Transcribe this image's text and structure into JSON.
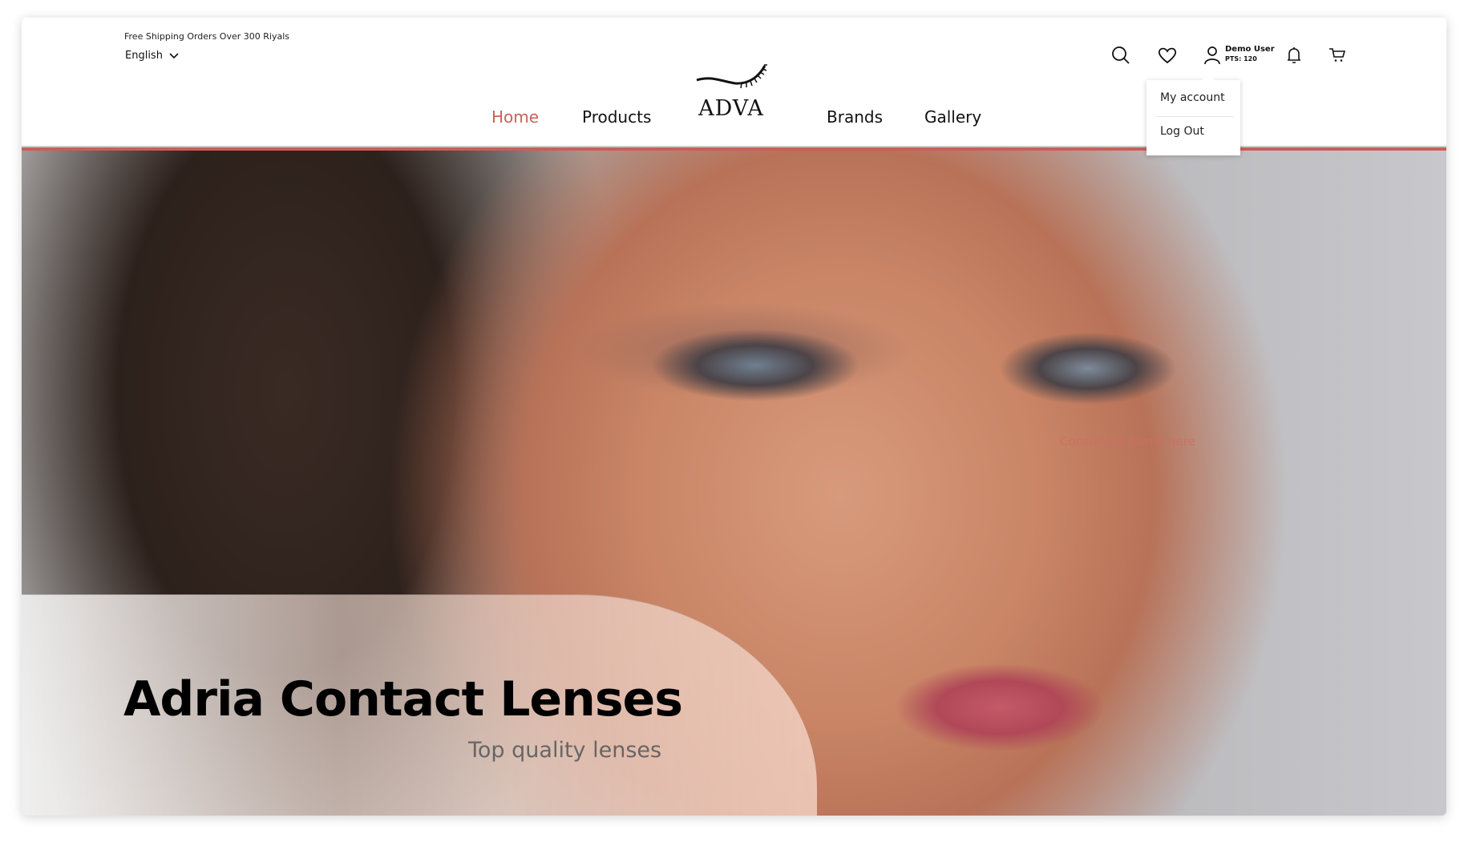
{
  "topbar": {
    "shipping_text": "Free Shipping Orders Over 300 Riyals",
    "language": "English"
  },
  "nav": {
    "items": [
      {
        "label": "Home",
        "active": true
      },
      {
        "label": "Products"
      },
      {
        "label": "Brands"
      },
      {
        "label": "Gallery"
      }
    ],
    "logo_text": "ADVA"
  },
  "user": {
    "name": "Demo User",
    "points": "PTS: 120"
  },
  "icons": [
    "search-icon",
    "heart-icon",
    "user-icon",
    "bell-icon",
    "cart-icon",
    "chevron-down-icon"
  ],
  "dropdown": {
    "items": [
      "My account",
      "Log Out"
    ]
  },
  "hero": {
    "consultant": "Consultant Name here",
    "title": "Adria Contact Lenses",
    "subtitle": "Top quality lenses"
  },
  "colors": {
    "accent": "#c6605a"
  }
}
